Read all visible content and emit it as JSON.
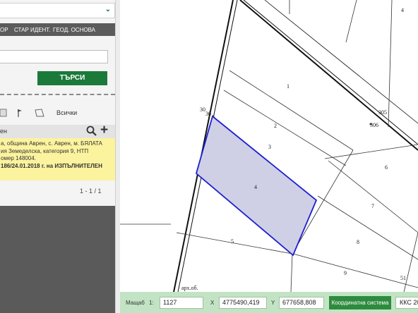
{
  "left_panel": {
    "search_tabs": [
      "ОР",
      "СТАР ИДЕНТ.",
      "ГЕОД. ОСНОВА"
    ],
    "search_button": "ТЪРСИ",
    "filter_label": "Всички",
    "results_header": "ен",
    "result": {
      "lines": [
        "а, община Аврен, с. Аврен, м. БЯЛАТА",
        "ия Земеделска, категория 9, НТП",
        "омер 148004.",
        "186/24.01.2018 г. на ИЗПЪЛНИТЕЛЕН"
      ]
    },
    "pager": "1 - 1 / 1"
  },
  "map": {
    "parcels": [
      "1",
      "2",
      "3",
      "4",
      "5",
      "6",
      "7",
      "8",
      "9"
    ],
    "labels": {
      "top_right": "4",
      "road_30": "30",
      "road_30_b": "30",
      "mark_305": "305",
      "mark_306": "306",
      "mark_51": "51",
      "bottom": "арх.об."
    },
    "selected_parcel": "4"
  },
  "status_bar": {
    "scale_label": "Мащаб",
    "scale_prefix": "1:",
    "scale_value": "1127",
    "x_label": "X",
    "x_value": "4775490,419",
    "y_label": "Y",
    "y_value": "677658,808",
    "coord_system_label": "Координатна система",
    "coord_system_value": "ККС 20"
  },
  "colors": {
    "accent": "#1b7a3a",
    "status_bar": "#c2e4c4",
    "selected_fill": "#cfd0e6",
    "selected_stroke": "#1f1fd0",
    "result_highlight": "#fbf39e"
  },
  "icons": {
    "dropdown": "chevron-down-icon",
    "zoom": "search-icon",
    "add": "plus-icon"
  }
}
